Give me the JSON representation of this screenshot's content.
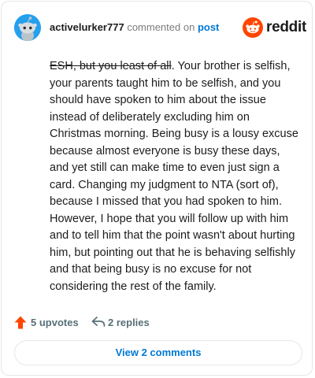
{
  "comment": {
    "username": "activelurker777",
    "commented_on_text": "commented on",
    "post_link": "post",
    "struck_text": "ESH, but you least of all",
    "body_text": ". Your brother is selfish, your parents taught him to be selfish, and you should have spoken to him about the issue instead of deliberately excluding him on Christmas morning. Being busy is a lousy excuse because almost everyone is busy these days, and yet still can make time to even just sign a card. Changing my judgment to NTA (sort of), because I missed that you had spoken to him. However, I hope that you will follow up with him and to tell him that the point wasn't about hurting him, but pointing out that he is behaving selfishly and that being busy is no excuse for not considering the rest of the family."
  },
  "brand": {
    "name": "reddit",
    "color": "#ff4500"
  },
  "actions": {
    "upvotes_label": "5 upvotes",
    "replies_label": "2 replies",
    "upvote_icon": "upvote-arrow-icon",
    "reply_icon": "reply-arrow-icon"
  },
  "footer": {
    "view_comments_label": "View 2 comments"
  },
  "colors": {
    "link": "#0079d3",
    "upvote": "#ff4500",
    "avatar_bg": "#24a0ed",
    "muted": "#576f76"
  }
}
